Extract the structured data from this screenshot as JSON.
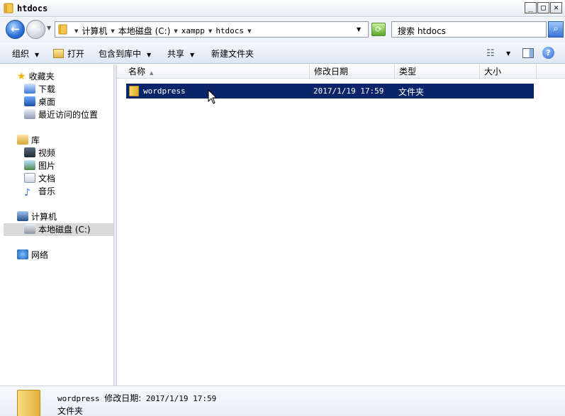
{
  "window": {
    "title": "htdocs",
    "controls": {
      "minimize": "_",
      "maximize": "□",
      "close": "✕"
    }
  },
  "address": {
    "crumbs": [
      "计算机",
      "本地磁盘 (C:)",
      "xampp",
      "htdocs"
    ]
  },
  "search": {
    "placeholder": "搜索 htdocs"
  },
  "toolbar": {
    "organize": "组织",
    "open": "打开",
    "include_library": "包含到库中",
    "share": "共享",
    "new_folder": "新建文件夹"
  },
  "nav": {
    "favorites": "收藏夹",
    "downloads": "下载",
    "desktop": "桌面",
    "recent": "最近访问的位置",
    "libraries": "库",
    "videos": "视频",
    "pictures": "图片",
    "documents": "文档",
    "music": "音乐",
    "computer": "计算机",
    "local_disk": "本地磁盘 (C:)",
    "network": "网络"
  },
  "columns": {
    "name": "名称",
    "modified": "修改日期",
    "type": "类型",
    "size": "大小"
  },
  "files": [
    {
      "name": "wordpress",
      "modified": "2017/1/19 17:59",
      "type": "文件夹",
      "size": ""
    }
  ],
  "details": {
    "name": "wordpress",
    "modified_label": "修改日期:",
    "modified": "2017/1/19 17:59",
    "type": "文件夹"
  },
  "colors": {
    "selection": "#0a246a",
    "nav_selected": "#d9d9d9",
    "accent": "#2a6fd6"
  },
  "icons": [
    "back-icon",
    "forward-icon",
    "folder-icon",
    "refresh-icon",
    "search-icon",
    "help-icon",
    "views-icon",
    "preview-pane-icon",
    "star-icon"
  ]
}
